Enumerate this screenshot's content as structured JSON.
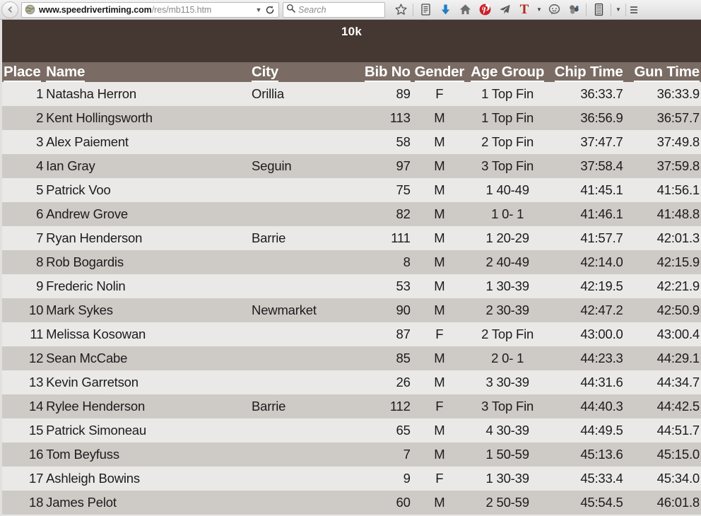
{
  "browser": {
    "back_label": "Back",
    "url_prefix": "www.speedrivertiming.com",
    "url_suffix": "/res/mb115.htm",
    "url_full": "www.speedrivertiming.com/res/mb115.htm",
    "search_placeholder": "Search",
    "toolbar_icons": [
      "bookmark-star-icon",
      "reading-list-icon",
      "download-arrow-icon",
      "home-icon",
      "pinterest-icon",
      "telegram-send-icon",
      "text-tool-icon",
      "chat-bubble-icon",
      "extension-icon",
      "archive-icon",
      "hamburger-menu-icon"
    ]
  },
  "page": {
    "title": "10k",
    "accent_banner_color": "#453731",
    "header_row_color": "#7a6c64",
    "row_color_odd": "#ebe9e7",
    "row_color_even": "#cecac6"
  },
  "table": {
    "columns": [
      "Place",
      "Name",
      "City",
      "Bib No",
      "Gender",
      "Age Group",
      "Chip Time",
      "Gun Time"
    ],
    "rows": [
      {
        "place": "1",
        "name": "Natasha Herron",
        "city": "Orillia",
        "bib": "89",
        "gender": "F",
        "age_group": "1 Top Fin",
        "chip_time": "36:33.7",
        "gun_time": "36:33.9"
      },
      {
        "place": "2",
        "name": "Kent Hollingsworth",
        "city": "",
        "bib": "113",
        "gender": "M",
        "age_group": "1 Top Fin",
        "chip_time": "36:56.9",
        "gun_time": "36:57.7"
      },
      {
        "place": "3",
        "name": "Alex Paiement",
        "city": "",
        "bib": "58",
        "gender": "M",
        "age_group": "2 Top Fin",
        "chip_time": "37:47.7",
        "gun_time": "37:49.8"
      },
      {
        "place": "4",
        "name": "Ian Gray",
        "city": "Seguin",
        "bib": "97",
        "gender": "M",
        "age_group": "3 Top Fin",
        "chip_time": "37:58.4",
        "gun_time": "37:59.8"
      },
      {
        "place": "5",
        "name": "Patrick Voo",
        "city": "",
        "bib": "75",
        "gender": "M",
        "age_group": "1 40-49",
        "chip_time": "41:45.1",
        "gun_time": "41:56.1"
      },
      {
        "place": "6",
        "name": "Andrew Grove",
        "city": "",
        "bib": "82",
        "gender": "M",
        "age_group": "1 0- 1",
        "chip_time": "41:46.1",
        "gun_time": "41:48.8"
      },
      {
        "place": "7",
        "name": "Ryan Henderson",
        "city": "Barrie",
        "bib": "111",
        "gender": "M",
        "age_group": "1 20-29",
        "chip_time": "41:57.7",
        "gun_time": "42:01.3"
      },
      {
        "place": "8",
        "name": "Rob Bogardis",
        "city": "",
        "bib": "8",
        "gender": "M",
        "age_group": "2 40-49",
        "chip_time": "42:14.0",
        "gun_time": "42:15.9"
      },
      {
        "place": "9",
        "name": "Frederic Nolin",
        "city": "",
        "bib": "53",
        "gender": "M",
        "age_group": "1 30-39",
        "chip_time": "42:19.5",
        "gun_time": "42:21.9"
      },
      {
        "place": "10",
        "name": "Mark Sykes",
        "city": "Newmarket",
        "bib": "90",
        "gender": "M",
        "age_group": "2 30-39",
        "chip_time": "42:47.2",
        "gun_time": "42:50.9"
      },
      {
        "place": "11",
        "name": "Melissa Kosowan",
        "city": "",
        "bib": "87",
        "gender": "F",
        "age_group": "2 Top Fin",
        "chip_time": "43:00.0",
        "gun_time": "43:00.4"
      },
      {
        "place": "12",
        "name": "Sean McCabe",
        "city": "",
        "bib": "85",
        "gender": "M",
        "age_group": "2 0- 1",
        "chip_time": "44:23.3",
        "gun_time": "44:29.1"
      },
      {
        "place": "13",
        "name": "Kevin Garretson",
        "city": "",
        "bib": "26",
        "gender": "M",
        "age_group": "3 30-39",
        "chip_time": "44:31.6",
        "gun_time": "44:34.7"
      },
      {
        "place": "14",
        "name": "Rylee Henderson",
        "city": "Barrie",
        "bib": "112",
        "gender": "F",
        "age_group": "3 Top Fin",
        "chip_time": "44:40.3",
        "gun_time": "44:42.5"
      },
      {
        "place": "15",
        "name": "Patrick Simoneau",
        "city": "",
        "bib": "65",
        "gender": "M",
        "age_group": "4 30-39",
        "chip_time": "44:49.5",
        "gun_time": "44:51.7"
      },
      {
        "place": "16",
        "name": "Tom Beyfuss",
        "city": "",
        "bib": "7",
        "gender": "M",
        "age_group": "1 50-59",
        "chip_time": "45:13.6",
        "gun_time": "45:15.0"
      },
      {
        "place": "17",
        "name": "Ashleigh Bowins",
        "city": "",
        "bib": "9",
        "gender": "F",
        "age_group": "1 30-39",
        "chip_time": "45:33.4",
        "gun_time": "45:34.0"
      },
      {
        "place": "18",
        "name": "James Pelot",
        "city": "",
        "bib": "60",
        "gender": "M",
        "age_group": "2 50-59",
        "chip_time": "45:54.5",
        "gun_time": "46:01.8"
      }
    ]
  }
}
